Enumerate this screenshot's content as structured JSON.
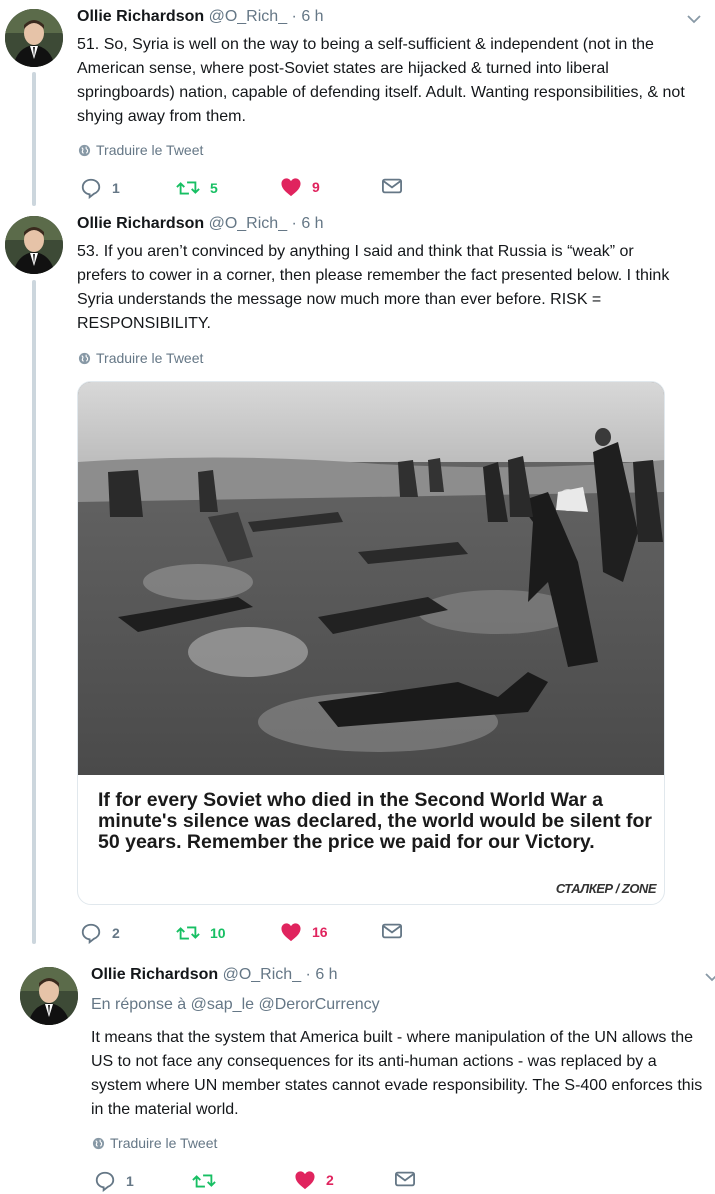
{
  "tweets": [
    {
      "name": "Ollie Richardson",
      "handle": "@O_Rich_",
      "time": "· 6 h",
      "text": "51. So, Syria is well on the way to being a self-sufficient & independent (not in the American sense, where post-Soviet states are hijacked & turned into liberal springboards) nation, capable of defending itself. Adult. Wanting responsibilities, & not shying away from them.",
      "translate": "Traduire le Tweet",
      "replies": "1",
      "retweets": "5",
      "likes": "9",
      "like_color": "#e0245e"
    },
    {
      "name": "Ollie Richardson",
      "handle": "@O_Rich_",
      "time": "· 6 h",
      "text": "53. If you aren’t convinced by anything I said and think that Russia is “weak” or prefers to cower in a corner, then please remember the fact presented below. I think Syria understands the message now much more than ever before. RISK = RESPONSIBILITY.",
      "translate": "Traduire le Tweet",
      "media_caption": "If for every Soviet who died in the Second World War a minute's silence was declared, the world would be silent for 50 years. Remember the price we paid for our Victory.",
      "media_watermark": "СТАЛКЕР / ZONE",
      "replies": "2",
      "retweets": "10",
      "likes": "16"
    },
    {
      "name": "Ollie Richardson",
      "handle": "@O_Rich_",
      "time": "· 6 h",
      "reply_prefix": "En réponse à",
      "reply_mentions": "@sap_le @DerorCurrency",
      "text": "It means that the system that America built - where manipulation of the UN allows the US to not face any consequences for its anti-human actions - was replaced by a system where UN member states cannot evade responsibility. The S-400 enforces this in the material world.",
      "translate": "Traduire le Tweet",
      "replies": "1",
      "retweets": "",
      "likes": "2"
    }
  ],
  "colors": {
    "retweet": "#17bf63",
    "like": "#e0245e",
    "muted": "#657786",
    "thread": "#ccd6dd"
  }
}
